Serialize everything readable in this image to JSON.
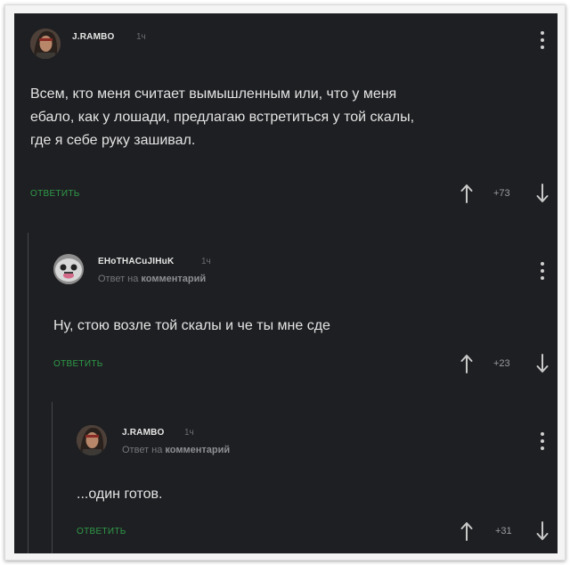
{
  "comments": [
    {
      "author": "J.RAMBO",
      "time": "1ч",
      "text_lines": [
        "Всем, кто меня считает вымышленным или, что у меня",
        "ебало, как у лошади, предлагаю встретиться у той скалы,",
        "где я себе руку зашивал."
      ],
      "reply_label": "ОТВЕТИТЬ",
      "score": "+73"
    },
    {
      "author": "EHoTHACuJIHuK",
      "time": "1ч",
      "reply_prefix": "Ответ на",
      "reply_target": "комментарий",
      "text_lines": [
        "Ну, стою возле той скалы и че ты мне сде"
      ],
      "reply_label": "ОТВЕТИТЬ",
      "score": "+23"
    },
    {
      "author": "J.RAMBO",
      "time": "1ч",
      "reply_prefix": "Ответ на",
      "reply_target": "комментарий",
      "text_lines": [
        "...один готов."
      ],
      "reply_label": "ОТВЕТИТЬ",
      "score": "+31"
    }
  ],
  "colors": {
    "background": "#1e1f22",
    "reply_button": "#2f9a48",
    "text": "#e4e4e4",
    "meta": "#6b6d72"
  },
  "icons": {
    "upvote": "arrow-up-icon",
    "downvote": "arrow-down-icon",
    "menu": "kebab-menu-icon"
  }
}
